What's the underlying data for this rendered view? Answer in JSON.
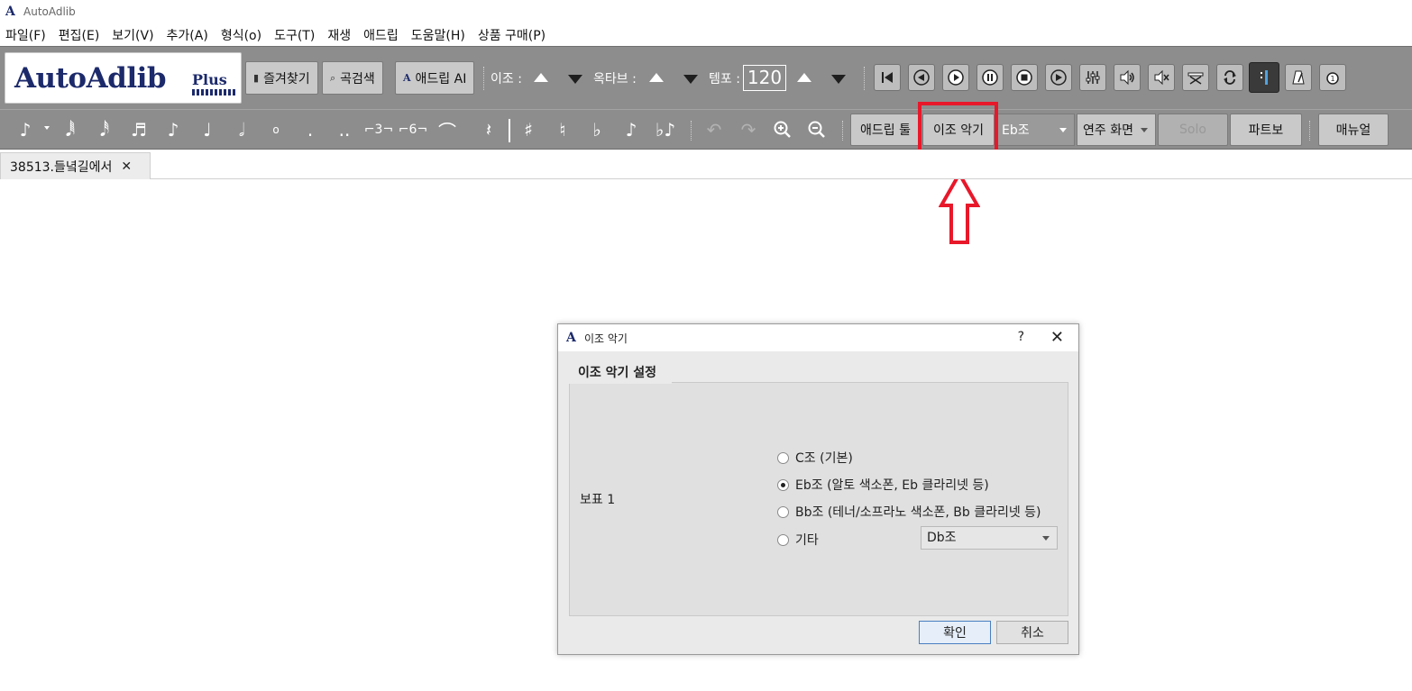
{
  "window": {
    "title": "AutoAdlib"
  },
  "menubar": {
    "items": [
      "파일(F)",
      "편집(E)",
      "보기(V)",
      "추가(A)",
      "형식(o)",
      "도구(T)",
      "재생",
      "애드립",
      "도움말(H)",
      "상품 구매(P)"
    ]
  },
  "logo": {
    "main": "AutoAdlib",
    "plus": "Plus"
  },
  "toolbar1": {
    "favorites": "즐겨찾기",
    "search": "곡검색",
    "adlib_ai": "애드립 AI",
    "transpose_label": "이조 :",
    "octave_label": "옥타브 :",
    "tempo_label": "템포 :",
    "tempo_value": "120"
  },
  "toolbar2": {
    "adlib_tool": "애드립 툴",
    "transpose_instrument": "이조 악기",
    "key_combo": "Eb조",
    "play_view_combo": "연주 화면",
    "solo": "Solo",
    "part_score": "파트보",
    "manual": "매뉴얼"
  },
  "tabs": [
    {
      "label": "38513.들녘길에서"
    }
  ],
  "dialog": {
    "title": "이조 악기",
    "help": "?",
    "group_title": "이조 악기 설정",
    "staff_label": "보표 1",
    "options": [
      {
        "label": "C조 (기본)",
        "checked": false
      },
      {
        "label": "Eb조 (알토 색소폰, Eb 클라리넷 등)",
        "checked": true
      },
      {
        "label": "Bb조 (테너/소프라노 색소폰, Bb 클라리넷 등)",
        "checked": false
      },
      {
        "label": "기타",
        "checked": false
      }
    ],
    "other_combo": "Db조",
    "ok": "확인",
    "cancel": "취소"
  },
  "colors": {
    "highlight": "#e8182a",
    "logo": "#1c2a6b",
    "toolbar": "#8d8d8d"
  }
}
